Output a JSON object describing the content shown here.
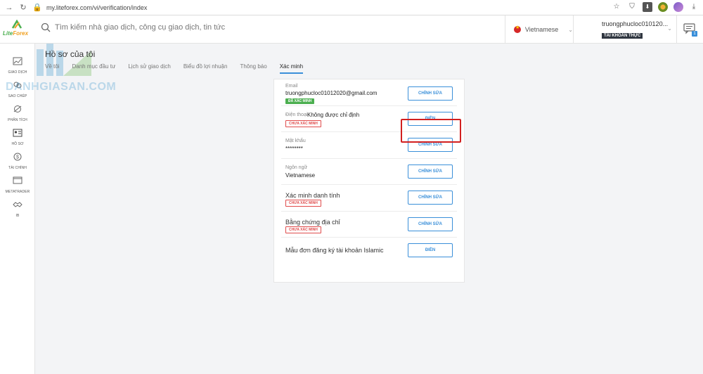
{
  "browser": {
    "url": "my.liteforex.com/vi/verification/index",
    "notif_count": "1"
  },
  "header": {
    "logo_text_1": "Lite",
    "logo_text_2": "Forex",
    "search_placeholder": "Tìm kiếm nhà giao dịch, công cụ giao dịch, tin tức",
    "language": "Vietnamese",
    "account_name": "truongphucloc010120...",
    "account_type": "TÀI KHOẢN THỰC"
  },
  "sidebar": {
    "items": [
      {
        "label": "GIAO DỊCH",
        "icon": "trade-chart-icon"
      },
      {
        "label": "SAO CHÉP",
        "icon": "copy-trading-icon"
      },
      {
        "label": "PHÂN TÍCH",
        "icon": "analysis-icon"
      },
      {
        "label": "HỒ SƠ",
        "icon": "profile-card-icon"
      },
      {
        "label": "TÀI CHÍNH",
        "icon": "dollar-icon"
      },
      {
        "label": "METATRADER",
        "icon": "monitor-icon"
      },
      {
        "label": "IB",
        "icon": "handshake-icon"
      }
    ]
  },
  "page": {
    "title": "Hồ sơ của tôi",
    "tabs": [
      "Về tôi",
      "Danh mục đầu tư",
      "Lịch sử giao dịch",
      "Biểu đồ lợi nhuận",
      "Thông báo",
      "Xác minh"
    ],
    "active_tab": "Xác minh"
  },
  "watermark": "DANHGIASAN.COM",
  "verification": {
    "email_label": "Email",
    "email_value": "truongphucloc01012020@gmail.com",
    "email_status": "ĐÃ XÁC MINH",
    "email_button": "CHỈNH SỬA",
    "phone_label": "Điện thoại",
    "phone_value": "Không được chỉ định",
    "phone_status": "CHƯA XÁC MINH",
    "phone_button": "ĐIỀN",
    "password_label": "Mật khẩu",
    "password_value": "********",
    "password_button": "CHỈNH SỬA",
    "language_label": "Ngôn ngữ",
    "language_value": "Vietnamese",
    "language_button": "CHỈNH SỬA",
    "identity_label": "Xác minh danh tính",
    "identity_status": "CHƯA XÁC MINH",
    "identity_button": "CHỈNH SỬA",
    "address_label": "Bằng chứng địa chỉ",
    "address_status": "CHƯA XÁC MINH",
    "address_button": "CHỈNH SỬA",
    "islamic_label": "Mẫu đơn đăng ký tài khoản Islamic",
    "islamic_button": "ĐIỀN"
  },
  "colors": {
    "accent": "#3a8fd9",
    "verified": "#4caf50",
    "unverified": "#e04b4b",
    "highlight": "#d21f1f"
  }
}
